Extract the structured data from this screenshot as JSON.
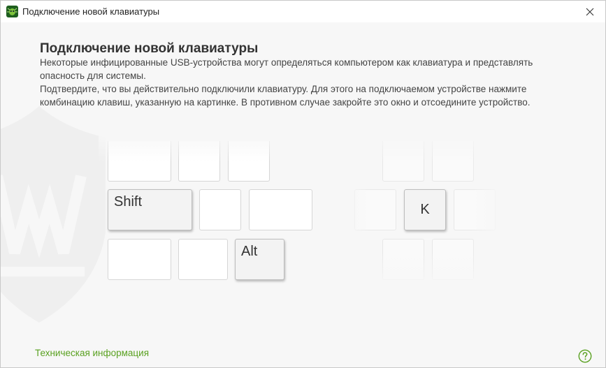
{
  "window": {
    "title": "Подключение новой клавиатуры",
    "accent_color": "#5aa121"
  },
  "main": {
    "heading": "Подключение новой клавиатуры",
    "paragraph1": "Некоторые инфицированные USB-устройства могут определяться компьютером как клавиатура и представлять опасность для системы.",
    "paragraph2": "Подтвердите, что вы действительно подключили клавиатуру. Для этого на подключаемом устройстве нажмите комбинацию клавиш, указанную на картинке. В противном случае закройте это окно и отсоедините устройство."
  },
  "keyboard": {
    "highlighted_keys": [
      "Shift",
      "Alt",
      "K"
    ]
  },
  "footer": {
    "tech_info_link": "Техническая информация"
  },
  "icons": {
    "app": "dr-web-spider-icon",
    "close": "close-icon",
    "help": "help-icon",
    "watermark": "dr-web-shield-logo"
  }
}
